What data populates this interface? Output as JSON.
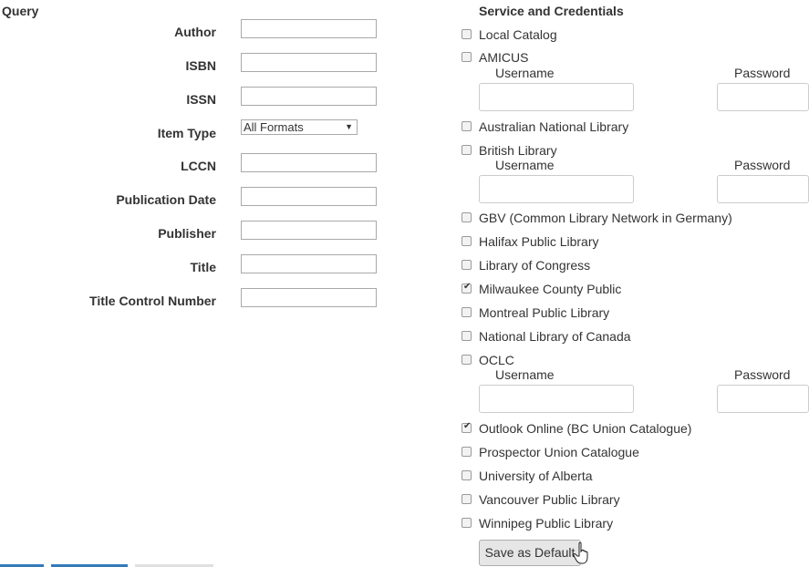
{
  "query": {
    "heading": "Query",
    "fields": [
      {
        "label": "Author",
        "value": ""
      },
      {
        "label": "ISBN",
        "value": ""
      },
      {
        "label": "ISSN",
        "value": ""
      },
      {
        "label": "Item Type",
        "value": "All Formats"
      },
      {
        "label": "LCCN",
        "value": ""
      },
      {
        "label": "Publication Date",
        "value": ""
      },
      {
        "label": "Publisher",
        "value": ""
      },
      {
        "label": "Title",
        "value": ""
      },
      {
        "label": "Title Control Number",
        "value": ""
      }
    ]
  },
  "services": {
    "heading": "Service and Credentials",
    "username_label": "Username",
    "password_label": "Password",
    "items": [
      {
        "label": "Local Catalog",
        "checked": false
      },
      {
        "label": "AMICUS",
        "checked": false
      },
      {
        "label": "Australian National Library",
        "checked": false
      },
      {
        "label": "British Library",
        "checked": false
      },
      {
        "label": "GBV (Common Library Network in Germany)",
        "checked": false
      },
      {
        "label": "Halifax Public Library",
        "checked": false
      },
      {
        "label": "Library of Congress",
        "checked": false
      },
      {
        "label": "Milwaukee County Public",
        "checked": true
      },
      {
        "label": "Montreal Public Library",
        "checked": false
      },
      {
        "label": "National Library of Canada",
        "checked": false
      },
      {
        "label": "OCLC",
        "checked": false
      },
      {
        "label": "Outlook Online (BC Union Catalogue)",
        "checked": true
      },
      {
        "label": "Prospector Union Catalogue",
        "checked": false
      },
      {
        "label": "University of Alberta",
        "checked": false
      },
      {
        "label": "Vancouver Public Library",
        "checked": false
      },
      {
        "label": "Winnipeg Public Library",
        "checked": false
      }
    ]
  },
  "actions": {
    "save_default_label": "Save as Default"
  },
  "colors": {
    "text": "#333333",
    "button_bg": "#e6e6e6",
    "bottom_tab_blue": "#337ab7"
  }
}
